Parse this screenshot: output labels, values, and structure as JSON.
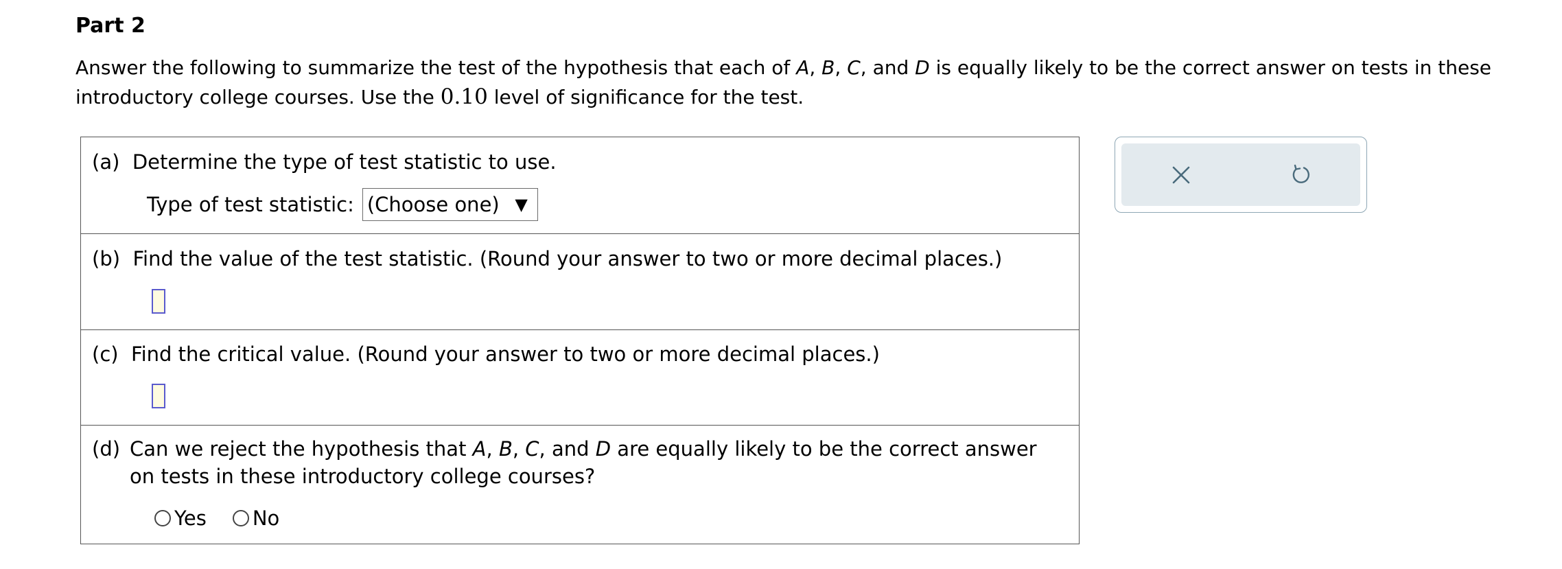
{
  "part": {
    "title": "Part 2"
  },
  "intro": {
    "text_1": "Answer the following to summarize the test of the hypothesis that each of ",
    "var_a": "A",
    "sep_1": ", ",
    "var_b": "B",
    "sep_2": ", ",
    "var_c": "C",
    "sep_3": ", and ",
    "var_d": "D",
    "text_2": " is equally likely to be the correct answer on tests in these introductory college courses. Use the ",
    "significance": "0.10",
    "text_3": " level of significance for the test."
  },
  "questions": {
    "a": {
      "label": "(a)",
      "text": "Determine the type of test statistic to use.",
      "field_label": "Type of test statistic:",
      "select_value": "(Choose one)",
      "select_arrow": "▼"
    },
    "b": {
      "label": "(b)",
      "text": "Find the value of the test statistic. (Round your answer to two or more decimal places.)",
      "input_value": ""
    },
    "c": {
      "label": "(c)",
      "text": "Find the critical value. (Round your answer to two or more decimal places.)",
      "input_value": ""
    },
    "d": {
      "label": "(d)",
      "text_1": "Can we reject the hypothesis that ",
      "var_a": "A",
      "sep_1": ", ",
      "var_b": "B",
      "sep_2": ", ",
      "var_c": "C",
      "sep_3": ", and ",
      "var_d": "D",
      "text_2": " are equally likely to be the correct answer on tests in these introductory college courses?",
      "options": [
        "Yes",
        "No"
      ]
    }
  },
  "toolbar": {
    "icons": [
      "close-icon",
      "undo-icon"
    ],
    "icon_color": "#4a6b7c",
    "background": "#e3eaee",
    "border": "#8ea7b5"
  },
  "colors": {
    "input_border": "#5a5acd",
    "input_fill": "#fffbe0",
    "table_border": "#555555"
  }
}
